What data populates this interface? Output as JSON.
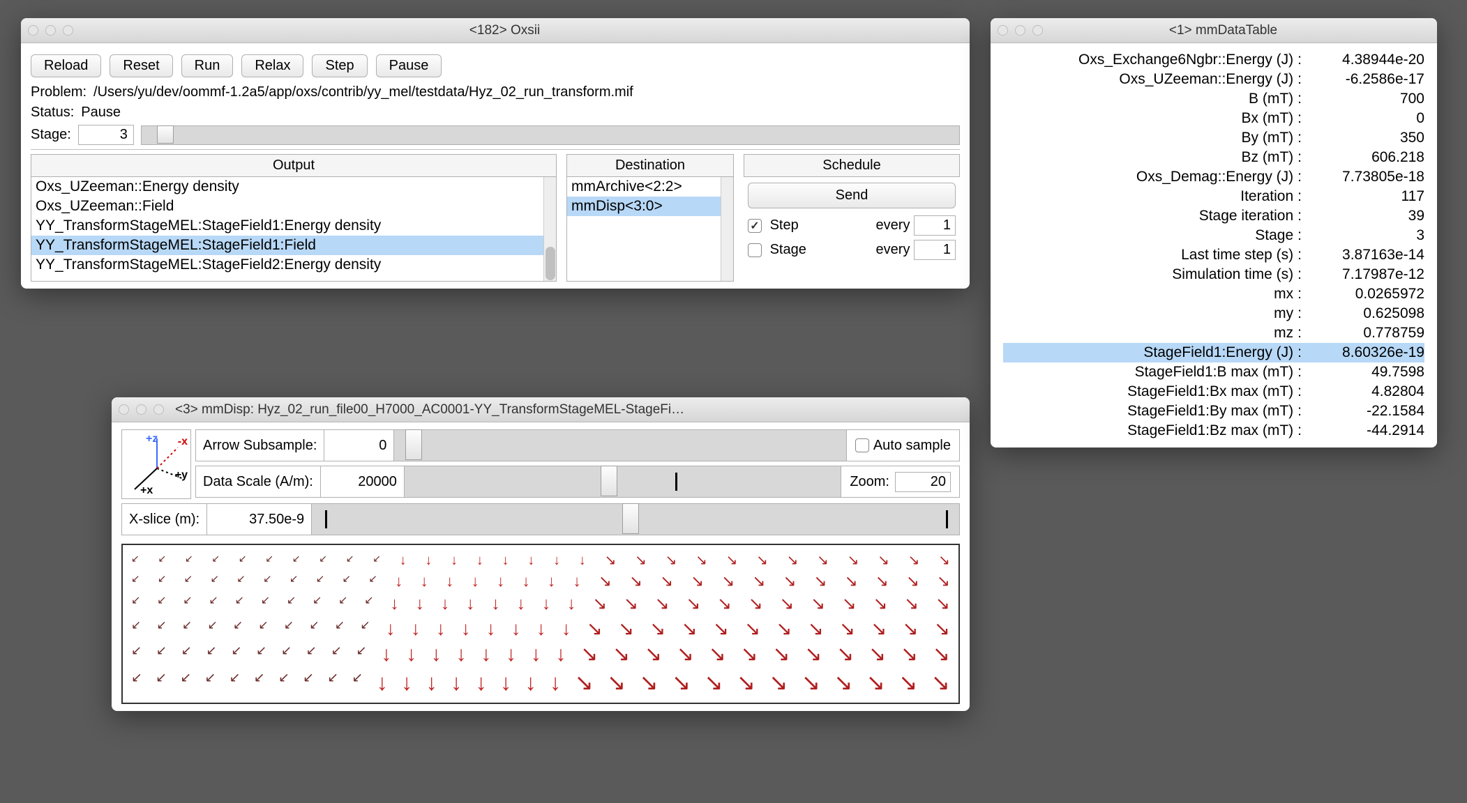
{
  "oxsii": {
    "title": "<182>  Oxsii",
    "buttons": {
      "reload": "Reload",
      "reset": "Reset",
      "run": "Run",
      "relax": "Relax",
      "step": "Step",
      "pause": "Pause"
    },
    "problem_label": "Problem:",
    "problem_path": "/Users/yu/dev/oommf-1.2a5/app/oxs/contrib/yy_mel/testdata/Hyz_02_run_transform.mif",
    "status_label": "Status:",
    "status_value": "Pause",
    "stage_label": "Stage:",
    "stage_value": "3",
    "headers": {
      "output": "Output",
      "destination": "Destination",
      "schedule": "Schedule"
    },
    "output_items": [
      {
        "label": "Oxs_UZeeman::Energy density",
        "selected": false
      },
      {
        "label": "Oxs_UZeeman::Field",
        "selected": false
      },
      {
        "label": "YY_TransformStageMEL:StageField1:Energy density",
        "selected": false
      },
      {
        "label": "YY_TransformStageMEL:StageField1:Field",
        "selected": true
      },
      {
        "label": "YY_TransformStageMEL:StageField2:Energy density",
        "selected": false
      }
    ],
    "dest_items": [
      {
        "label": "mmArchive<2:2>",
        "selected": false
      },
      {
        "label": "mmDisp<3:0>",
        "selected": true
      }
    ],
    "send_label": "Send",
    "step_checkbox_label": "Step",
    "stage_checkbox_label": "Stage",
    "every_label": "every",
    "step_every": "1",
    "stage_every": "1"
  },
  "mmdisp": {
    "title": "<3> mmDisp: Hyz_02_run_file00_H7000_AC0001-YY_TransformStageMEL-StageFi…",
    "axes": {
      "pz": "+z",
      "mx_top": "-x",
      "py": "+y",
      "mx_bot": "+x"
    },
    "arrow_subsample_label": "Arrow Subsample:",
    "arrow_subsample": "0",
    "auto_sample_label": "Auto sample",
    "data_scale_label": "Data Scale (A/m):",
    "data_scale": "20000",
    "zoom_label": "Zoom:",
    "zoom": "20",
    "xslice_label": "X-slice (m):",
    "xslice": "37.50e-9"
  },
  "datatable": {
    "title": "<1> mmDataTable",
    "rows": [
      {
        "k": "Oxs_Exchange6Ngbr::Energy (J)",
        "v": "4.38944e-20"
      },
      {
        "k": "Oxs_UZeeman::Energy (J)",
        "v": "-6.2586e-17"
      },
      {
        "k": "B (mT)",
        "v": "700"
      },
      {
        "k": "Bx (mT)",
        "v": "0"
      },
      {
        "k": "By (mT)",
        "v": "350"
      },
      {
        "k": "Bz (mT)",
        "v": "606.218"
      },
      {
        "k": "Oxs_Demag::Energy (J)",
        "v": "7.73805e-18"
      },
      {
        "k": "Iteration",
        "v": "117"
      },
      {
        "k": "Stage iteration",
        "v": "39"
      },
      {
        "k": "Stage",
        "v": "3"
      },
      {
        "k": "Last time step (s)",
        "v": "3.87163e-14"
      },
      {
        "k": "Simulation time (s)",
        "v": "7.17987e-12"
      },
      {
        "k": "mx",
        "v": "0.0265972"
      },
      {
        "k": "my",
        "v": "0.625098"
      },
      {
        "k": "mz",
        "v": "0.778759"
      },
      {
        "k": "StageField1:Energy (J)",
        "v": "8.60326e-19",
        "sel": true
      },
      {
        "k": "StageField1:B max (mT)",
        "v": "49.7598"
      },
      {
        "k": "StageField1:Bx max (mT)",
        "v": "4.82804"
      },
      {
        "k": "StageField1:By max (mT)",
        "v": "-22.1584"
      },
      {
        "k": "StageField1:Bz max (mT)",
        "v": "-44.2914"
      }
    ]
  }
}
